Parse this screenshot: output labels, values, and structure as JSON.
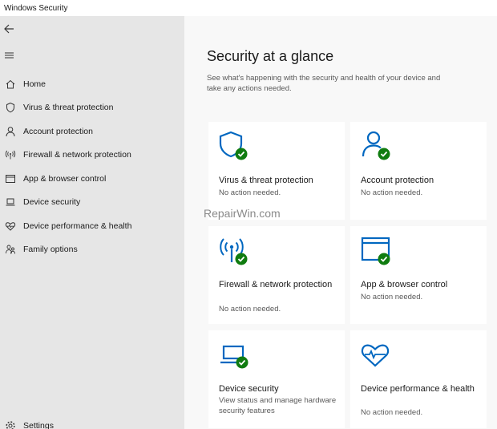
{
  "window": {
    "title": "Windows Security"
  },
  "sidebar": {
    "items": [
      {
        "label": "Home",
        "icon": "home-icon"
      },
      {
        "label": "Virus & threat protection",
        "icon": "shield-icon"
      },
      {
        "label": "Account protection",
        "icon": "person-icon"
      },
      {
        "label": "Firewall & network protection",
        "icon": "antenna-icon"
      },
      {
        "label": "App & browser control",
        "icon": "window-icon"
      },
      {
        "label": "Device security",
        "icon": "laptop-icon"
      },
      {
        "label": "Device performance & health",
        "icon": "heart-icon"
      },
      {
        "label": "Family options",
        "icon": "family-icon"
      }
    ],
    "settings_label": "Settings"
  },
  "main": {
    "title": "Security at a glance",
    "subtitle": "See what's happening with the security and health of your device and take any actions needed.",
    "cards": [
      {
        "title": "Virus & threat protection",
        "status": "No action needed.",
        "icon": "shield-check-icon"
      },
      {
        "title": "Account protection",
        "status": "No action needed.",
        "icon": "person-check-icon"
      },
      {
        "title": "Firewall & network protection",
        "status": "No action needed.",
        "icon": "antenna-check-icon"
      },
      {
        "title": "App & browser control",
        "status": "No action needed.",
        "icon": "window-check-icon"
      },
      {
        "title": "Device security",
        "status": "View status and manage hardware security features",
        "icon": "laptop-check-icon"
      },
      {
        "title": "Device performance & health",
        "status": "No action needed.",
        "icon": "heart-check-icon"
      }
    ]
  },
  "watermark": "RepairWin.com",
  "colors": {
    "accent": "#0067c0",
    "ok": "#107c10",
    "sidebar_bg": "#e6e6e6",
    "main_bg": "#f8f8f8"
  }
}
